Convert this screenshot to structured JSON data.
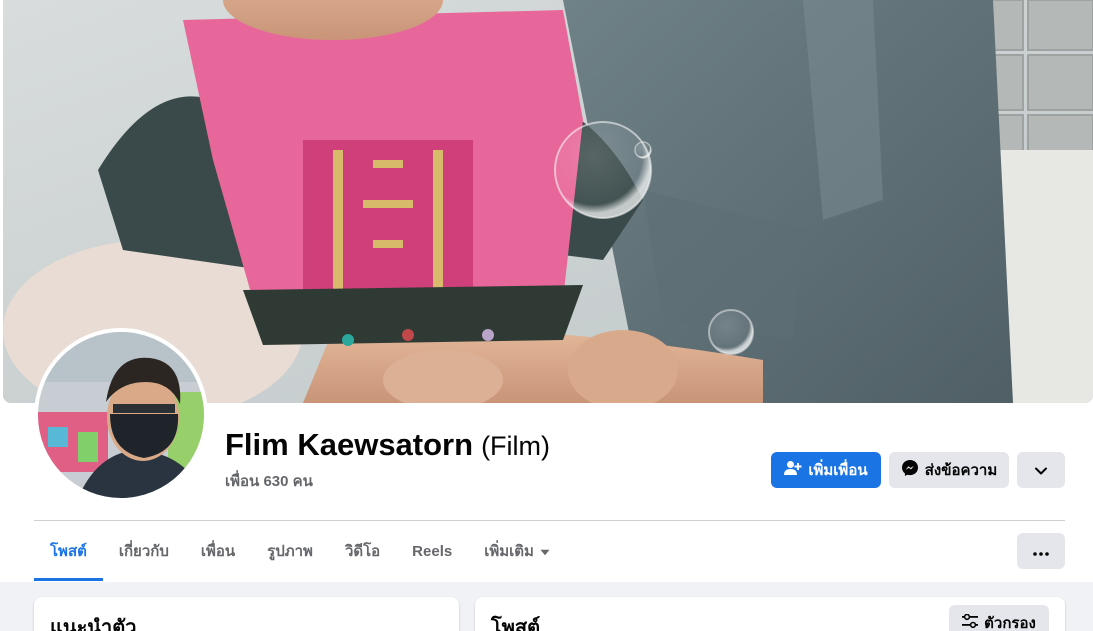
{
  "profile": {
    "name": "Flim Kaewsatorn",
    "alternate_name": "(Film)",
    "friends_label": "เพื่อน 630 คน"
  },
  "actions": {
    "add_friend_label": "เพิ่มเพื่อน",
    "message_label": "ส่งข้อความ",
    "more_icon": "chevron-down-icon"
  },
  "tabs": [
    {
      "label": "โพสต์",
      "active": true
    },
    {
      "label": "เกี่ยวกับ",
      "active": false
    },
    {
      "label": "เพื่อน",
      "active": false
    },
    {
      "label": "รูปภาพ",
      "active": false
    },
    {
      "label": "วิดีโอ",
      "active": false
    },
    {
      "label": "Reels",
      "active": false
    },
    {
      "label": "เพิ่มเติม",
      "active": false
    }
  ],
  "sections": {
    "intro_title": "แนะนำตัว",
    "posts_title": "โพสต์",
    "filter_label": "ตัวกรอง"
  },
  "colors": {
    "accent": "#1b74e4",
    "secondary_button": "#e4e6eb",
    "muted_text": "#65676b",
    "background": "#f0f2f5"
  }
}
